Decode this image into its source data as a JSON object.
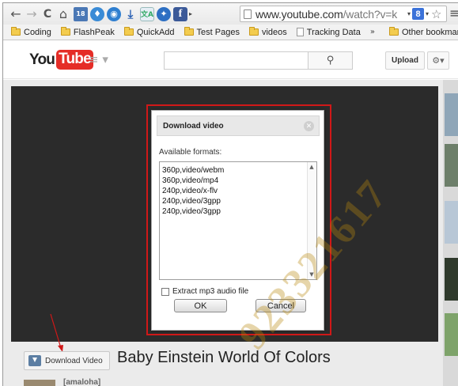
{
  "browser": {
    "url_main": "www.youtube.com",
    "url_rest": "/watch?v=k",
    "bookmarks": [
      {
        "label": "Coding",
        "type": "folder"
      },
      {
        "label": "FlashPeak",
        "type": "folder"
      },
      {
        "label": "QuickAdd",
        "type": "folder"
      },
      {
        "label": "Test Pages",
        "type": "folder"
      },
      {
        "label": "videos",
        "type": "folder"
      },
      {
        "label": "Tracking Data",
        "type": "page"
      }
    ],
    "other_bookmarks": "Other bookmarks",
    "more_glyph": "»",
    "ext_badge": "18",
    "google_icon_letter": "8"
  },
  "youtube": {
    "logo_you": "You",
    "logo_tube": "Tube",
    "upload_label": "Upload",
    "search_placeholder": ""
  },
  "dialog": {
    "title": "Download video",
    "formats_label": "Available formats:",
    "formats": [
      "360p,video/webm",
      "360p,video/mp4",
      "240p,video/x-flv",
      "240p,video/3gpp",
      "240p,video/3gpp"
    ],
    "extract_label": "Extract mp3 audio file",
    "extract_checked": false,
    "ok_label": "OK",
    "cancel_label": "Cancel"
  },
  "video": {
    "download_button_label": "Download Video",
    "title": "Baby Einstein World Of Colors",
    "channel_name": "[amaloha]"
  },
  "overlay": {
    "watermark_text": "923321617"
  },
  "colors": {
    "highlight_red": "#d01818",
    "yt_red": "#e52d27",
    "player_bg": "#2b2b2b"
  }
}
